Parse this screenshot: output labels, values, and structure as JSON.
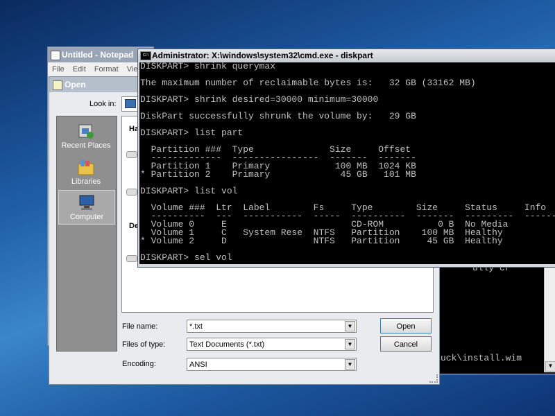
{
  "notepad": {
    "title": "Untitled - Notepad",
    "menu": [
      "File",
      "Edit",
      "Format",
      "Vie"
    ]
  },
  "open_dialog": {
    "title": "Open",
    "look_in_label": "Look in:",
    "places": [
      "Recent Places",
      "Libraries",
      "Computer"
    ],
    "list_header_1": "Ha",
    "list_header_2": "De",
    "file_name_label": "File name:",
    "file_name_value": "*.txt",
    "files_of_type_label": "Files of type:",
    "files_of_type_value": "Text Documents (*.txt)",
    "encoding_label": "Encoding:",
    "encoding_value": "ANSI",
    "open_button": "Open",
    "cancel_button": "Cancel"
  },
  "cmd": {
    "title": "Administrator: X:\\windows\\system32\\cmd.exe - diskpart",
    "lines": [
      "DISKPART> shrink querymax",
      "",
      "The maximum number of reclaimable bytes is:   32 GB (33162 MB)",
      "",
      "DISKPART> shrink desired=30000 minimum=30000",
      "",
      "DiskPart successfully shrunk the volume by:   29 GB",
      "",
      "DISKPART> list part",
      "",
      "  Partition ###  Type              Size     Offset",
      "  -------------  ----------------  -------  -------",
      "  Partition 1    Primary            100 MB  1024 KB",
      "* Partition 2    Primary             45 GB   101 MB",
      "",
      "DISKPART> list vol",
      "",
      "  Volume ###  Ltr  Label        Fs     Type        Size     Status     Info",
      "  ----------  ---  -----------  -----  ----------  -------  ---------  --------",
      "  Volume 0     E                       CD-ROM          0 B  No Media",
      "  Volume 1     C   System Rese  NTFS   Partition    100 MB  Healthy",
      "* Volume 2     D                NTFS   Partition     45 GB  Healthy",
      "",
      "DISKPART> sel vol"
    ]
  },
  "background_cmd": {
    "line_1": "ully cr",
    "line_2": "uck\\install.wim"
  }
}
